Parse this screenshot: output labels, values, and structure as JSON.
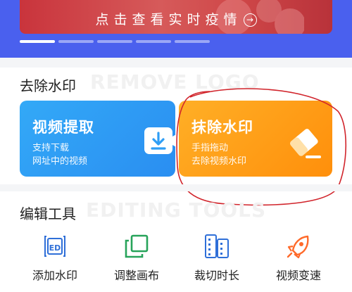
{
  "banner": {
    "text": "点击查看实时疫情",
    "arrow": "→"
  },
  "carousel": {
    "dot_count": 5,
    "active_index": 0
  },
  "remove_section": {
    "title": "去除水印",
    "watermark": "REMOVE LOGO"
  },
  "cards": {
    "extract": {
      "title": "视频提取",
      "line1": "支持下载",
      "line2": "网址中的视频",
      "icon": "download-video-icon",
      "color": "#2f9ef5"
    },
    "erase": {
      "title": "抹除水印",
      "line1": "手指拖动",
      "line2": "去除视频水印",
      "icon": "eraser-icon",
      "color": "#ff9d17"
    }
  },
  "edit_section": {
    "title": "编辑工具",
    "watermark": "EDITING TOOLS"
  },
  "tools": [
    {
      "label": "添加水印",
      "icon": "add-watermark-icon"
    },
    {
      "label": "调整画布",
      "icon": "adjust-canvas-icon"
    },
    {
      "label": "裁切时长",
      "icon": "trim-duration-icon"
    },
    {
      "label": "视频变速",
      "icon": "rocket-speed-icon"
    }
  ],
  "colors": {
    "header_blue": "#4a60ee",
    "annotation_red": "#d1242b",
    "tool_blue": "#2f6fd8",
    "tool_green": "#27a35a",
    "tool_orange": "#ff6a2a"
  }
}
